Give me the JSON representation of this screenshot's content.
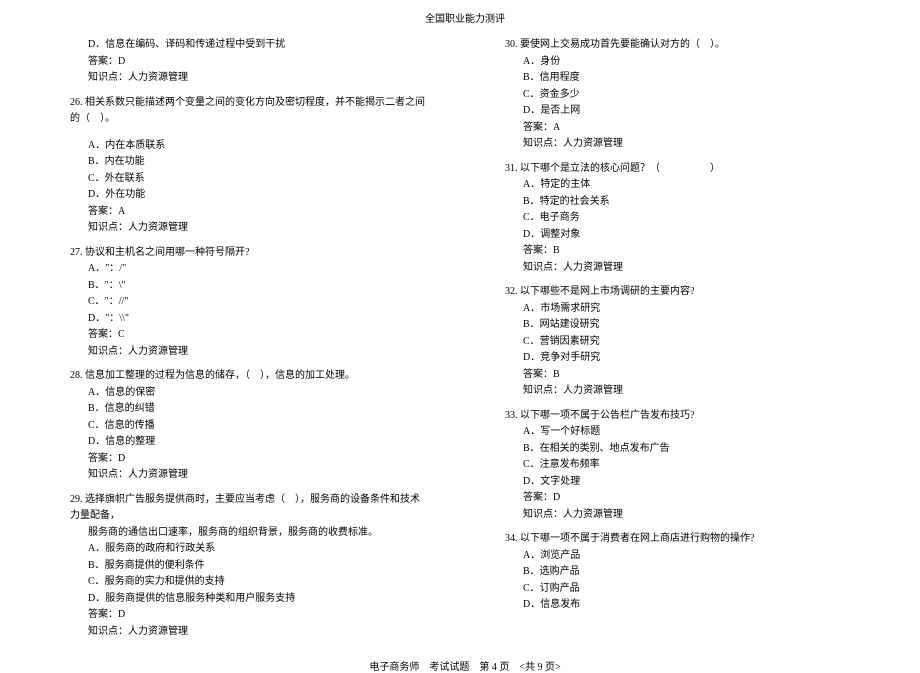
{
  "header": "全国职业能力测评",
  "footer": "电子商务师　考试试题　第 4 页　<共 9 页>",
  "leftColumn": {
    "partial_option_d": "D．信息在编码、译码和传递过程中受到干扰",
    "partial_answer": "答案：D",
    "partial_knowledge": "知识点：人力资源管理",
    "questions": [
      {
        "num": "26.",
        "stem": "相关系数只能描述两个变量之间的变化方向及密切程度，并不能揭示二者之间的（　）。",
        "options": [
          "A．内在本质联系",
          "B．内在功能",
          "C．外在联系",
          "D．外在功能"
        ],
        "answer": "答案：A",
        "knowledge": "知识点：人力资源管理"
      },
      {
        "num": "27.",
        "stem": "协议和主机名之间用哪一种符号隔开?",
        "options": [
          "A．\"：/\"",
          "B．\"：\\\"",
          "C．\"：//\"",
          "D．\"：\\\\\""
        ],
        "answer": "答案：C",
        "knowledge": "知识点：人力资源管理"
      },
      {
        "num": "28.",
        "stem": "信息加工整理的过程为信息的储存，（　），信息的加工处理。",
        "options": [
          "A．信息的保密",
          "B．信息的纠错",
          "C．信息的传播",
          "D．信息的整理"
        ],
        "answer": "答案：D",
        "knowledge": "知识点：人力资源管理"
      },
      {
        "num": "29.",
        "stem": "选择旗帜广告服务提供商时，主要应当考虑（　），服务商的设备条件和技术力量配备，",
        "stem2": "服务商的通信出口速率，服务商的组织背景，服务商的收费标准。",
        "options": [
          "A．服务商的政府和行政关系",
          "B．服务商提供的便利条件",
          "C．服务商的实力和提供的支持",
          "D．服务商提供的信息服务种类和用户服务支持"
        ],
        "answer": "答案：D",
        "knowledge": "知识点：人力资源管理"
      }
    ]
  },
  "rightColumn": {
    "questions": [
      {
        "num": "30.",
        "stem": "要使网上交易成功首先要能确认对方的（　）。",
        "options": [
          "A．身份",
          "B．信用程度",
          "C．资金多少",
          "D．是否上网"
        ],
        "answer": "答案：A",
        "knowledge": "知识点：人力资源管理"
      },
      {
        "num": "31.",
        "stem": "以下哪个是立法的核心问题？（　　　　　）",
        "options": [
          "A．特定的主体",
          "B．特定的社会关系",
          "C．电子商务",
          "D．调整对象"
        ],
        "answer": "答案：B",
        "knowledge": "知识点：人力资源管理"
      },
      {
        "num": "32.",
        "stem": "以下哪些不是网上市场调研的主要内容?",
        "options": [
          "A．市场需求研究",
          "B．网站建设研究",
          "C．营销因素研究",
          "D．竞争对手研究"
        ],
        "answer": "答案：B",
        "knowledge": "知识点：人力资源管理"
      },
      {
        "num": "33.",
        "stem": "以下哪一项不属于公告栏广告发布技巧?",
        "options": [
          "A．写一个好标题",
          "B．在相关的类别、地点发布广告",
          "C．注意发布频率",
          "D．文字处理"
        ],
        "answer": "答案：D",
        "knowledge": "知识点：人力资源管理"
      },
      {
        "num": "34.",
        "stem": "以下哪一项不属于消费者在网上商店进行购物的操作?",
        "options": [
          "A．浏览产品",
          "B．选购产品",
          "C．订购产品",
          "D．信息发布"
        ],
        "answer": "",
        "knowledge": ""
      }
    ]
  }
}
